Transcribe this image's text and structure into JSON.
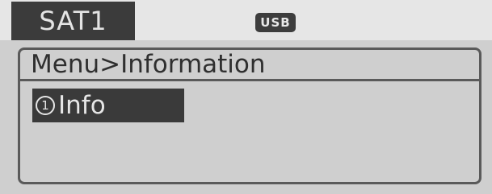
{
  "header": {
    "source": "SAT1",
    "badge": "USB"
  },
  "breadcrumb": "Menu>Information",
  "menu": {
    "items": [
      {
        "number": "1",
        "label": "Info",
        "selected": true
      }
    ]
  },
  "colors": {
    "screen_background": "#cfcfcf",
    "header_background": "#e6e6e6",
    "highlight": "#3a3a3a",
    "text_dark": "#2f2f2f",
    "text_light": "#e6e6e6"
  }
}
